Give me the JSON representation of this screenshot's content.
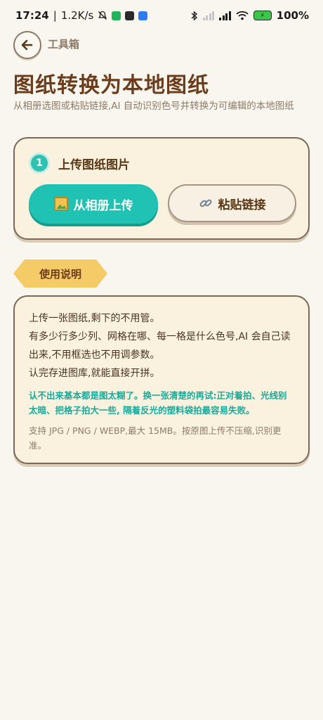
{
  "status_bar": {
    "time": "17:24",
    "speed": "1.2K/s",
    "battery": "100%",
    "separator": "|"
  },
  "header": {
    "breadcrumb": "工具箱",
    "title": "图纸转换为本地图纸",
    "subtitle": "从相册选图或粘贴链接,AI 自动识别色号并转换为可编辑的本地图纸"
  },
  "upload": {
    "step_number": "1",
    "step_label": "上传图纸图片",
    "album_button": "从相册上传",
    "link_button": "粘贴链接"
  },
  "instructions": {
    "ribbon_label": "使用说明",
    "main_lines": [
      "上传一张图纸,剩下的不用管。",
      "有多少行多少列、网格在哪、每一格是什么色号,AI 会自己读出来,不用框选也不用调参数。",
      "认完存进图库,就能直接开拼。"
    ],
    "tip": "认不出来基本都是图太糊了。换一张清楚的再试:正对着拍、光线别太暗、把格子拍大一些, 隔着反光的塑料袋拍最容易失败。",
    "note": "支持 JPG / PNG / WEBP,最大 15MB。按原图上传不压缩,识别更准。"
  },
  "colors": {
    "accent_teal": "#1fc2b3",
    "title_brown": "#6b3d1c",
    "ribbon_yellow": "#f5cb67",
    "card_bg": "#faf2de"
  },
  "icons": [
    "back-arrow-icon",
    "mute-bell-icon",
    "bluetooth-icon",
    "wifi-icon",
    "battery-icon",
    "picture-icon",
    "link-icon"
  ]
}
